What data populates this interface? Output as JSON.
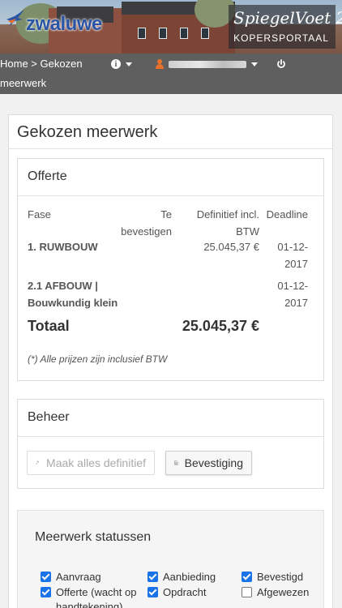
{
  "header": {
    "logo_left": "zwaluwe",
    "logo_right_title": "SpiegelVoet 2",
    "logo_right_subtitle": "KOPERSPORTAAL"
  },
  "nav": {
    "breadcrumb_home": "Home",
    "breadcrumb_sep": " > ",
    "breadcrumb_current_line1": "Gekozen",
    "breadcrumb_current_line2": "meerwerk",
    "icons": [
      "info-icon",
      "user-icon",
      "power-icon"
    ]
  },
  "page": {
    "title": "Gekozen meerwerk"
  },
  "offerte": {
    "title": "Offerte",
    "columns": {
      "fase": "Fase",
      "bevestigen_1": "Te",
      "bevestigen_2": "bevestigen",
      "definitief_1": "Definitief incl.",
      "definitief_2": "BTW",
      "deadline": "Deadline"
    },
    "rows": [
      {
        "fase_1": "1. RUWBOUW",
        "fase_2": "",
        "te_bevestigen": "",
        "definitief": "25.045,37 €",
        "deadline_1": "01-12-",
        "deadline_2": "2017"
      },
      {
        "fase_1": "2.1 AFBOUW |",
        "fase_2": "Bouwkundig klein",
        "te_bevestigen": "",
        "definitief": "",
        "deadline_1": "01-12-",
        "deadline_2": "2017"
      }
    ],
    "totaal_label": "Totaal",
    "totaal_value": "25.045,37 €",
    "note": "(*) Alle prijzen zijn inclusief BTW"
  },
  "beheer": {
    "title": "Beheer",
    "btn_definitief": "Maak alles definitief",
    "btn_bevestiging": "Bevestiging"
  },
  "statussen": {
    "title": "Meerwerk statussen",
    "items": [
      {
        "label": "Aanvraag",
        "checked": true
      },
      {
        "label": "Aanbieding",
        "checked": true
      },
      {
        "label": "Bevestigd",
        "checked": true
      },
      {
        "label": "Offerte (wacht op handtekening)",
        "checked": true
      },
      {
        "label": "Opdracht",
        "checked": true
      },
      {
        "label": "Afgewezen",
        "checked": false
      }
    ]
  },
  "colors": {
    "nav_bg": "#5f5f5f",
    "brand_blue": "#2a55a5",
    "checkbox_blue": "#1a73e8",
    "user_icon": "#e8702a"
  }
}
